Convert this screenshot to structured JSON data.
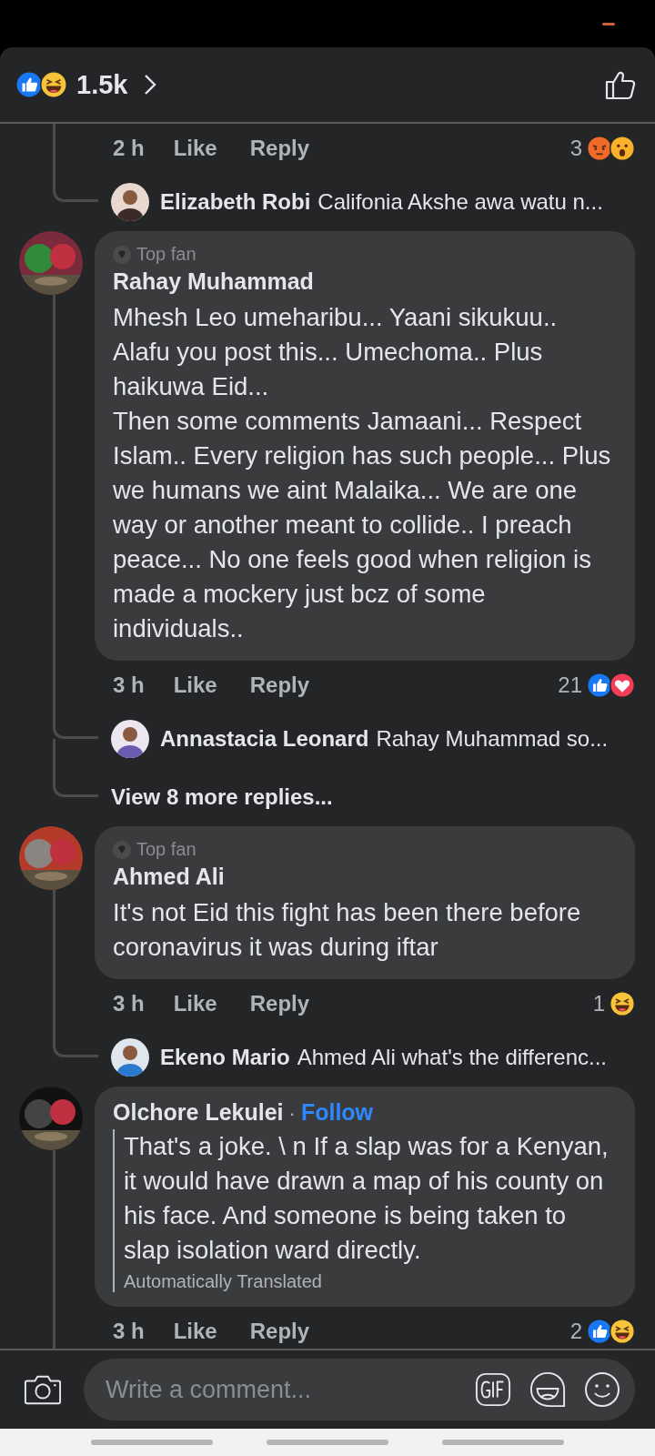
{
  "header": {
    "reactions": [
      {
        "kind": "like"
      },
      {
        "kind": "haha"
      }
    ],
    "count": "1.5k"
  },
  "threads": [
    {
      "meta": {
        "time": "2 h",
        "like": "Like",
        "reply": "Reply",
        "count": "3",
        "reactions": [
          {
            "kind": "angry"
          },
          {
            "kind": "wow"
          }
        ]
      },
      "replies": [
        {
          "name": "Elizabeth Robi",
          "text": "Califonia Akshe awa  watu n..."
        }
      ]
    },
    {
      "author": "Rahay Muhammad",
      "badge": "Top fan",
      "text": "Mhesh Leo umeharibu... Yaani sikukuu.. Alafu you post this... Umechoma.. Plus haikuwa Eid...\nThen some comments Jamaani... Respect Islam.. Every religion has such people... Plus we humans we aint Malaika... We are one way  or another meant to collide.. I preach peace... No one feels good when religion is made a mockery just bcz of some individuals..",
      "meta": {
        "time": "3 h",
        "like": "Like",
        "reply": "Reply",
        "count": "21",
        "reactions": [
          {
            "kind": "like"
          },
          {
            "kind": "love"
          }
        ]
      },
      "replies": [
        {
          "name": "Annastacia Leonard",
          "text": "Rahay Muhammad so..."
        }
      ],
      "more": "View 8 more replies..."
    },
    {
      "author": "Ahmed Ali",
      "badge": "Top fan",
      "text": "It's  not Eid this fight has been there before coronavirus it was during iftar",
      "meta": {
        "time": "3 h",
        "like": "Like",
        "reply": "Reply",
        "count": "1",
        "reactions": [
          {
            "kind": "haha"
          }
        ]
      },
      "replies": [
        {
          "name": "Ekeno Mario",
          "text": "Ahmed Ali what's the differenc..."
        }
      ]
    },
    {
      "author": "Olchore Lekulei",
      "separator": "·",
      "follow": "Follow",
      "text": "That's a joke. \\ n If a slap was for a Kenyan, it would have drawn a map of his county on his face. And someone is being taken to slap isolation ward directly.",
      "translated": "Automatically Translated",
      "meta": {
        "time": "3 h",
        "like": "Like",
        "reply": "Reply",
        "count": "2",
        "reactions": [
          {
            "kind": "like"
          },
          {
            "kind": "haha"
          }
        ]
      }
    }
  ],
  "composer": {
    "placeholder": "Write a comment..."
  }
}
